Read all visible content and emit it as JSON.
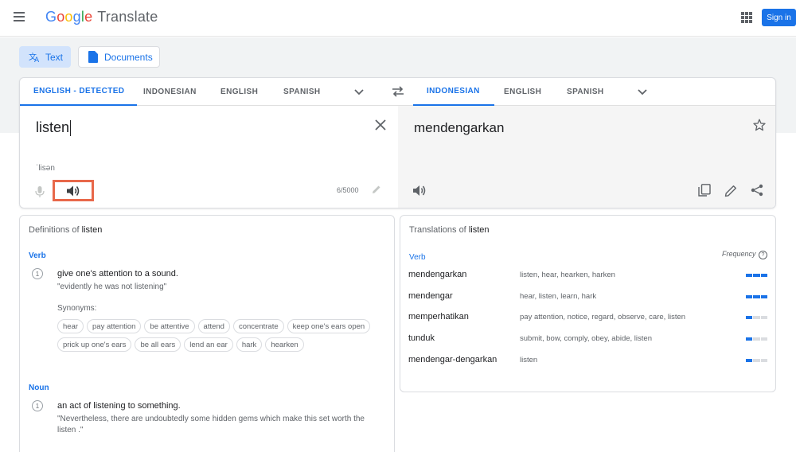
{
  "header": {
    "logo_letters": [
      "G",
      "o",
      "o",
      "g",
      "l",
      "e"
    ],
    "product": "Translate",
    "signin_label": "Sign in"
  },
  "modes": {
    "text_label": "Text",
    "documents_label": "Documents"
  },
  "source_tabs": [
    "ENGLISH - DETECTED",
    "INDONESIAN",
    "ENGLISH",
    "SPANISH"
  ],
  "target_tabs": [
    "INDONESIAN",
    "ENGLISH",
    "SPANISH"
  ],
  "source": {
    "text": "listen",
    "transliteration": "ˈlisən",
    "char_count": "6/5000"
  },
  "target": {
    "text": "mendengarkan"
  },
  "definitions": {
    "title_prefix": "Definitions of",
    "word": "listen",
    "verb_label": "Verb",
    "verb_num": "1",
    "verb_def": "give one's attention to a sound.",
    "verb_example": "\"evidently he was not listening\"",
    "synonyms_label": "Synonyms:",
    "synonyms": [
      "hear",
      "pay attention",
      "be attentive",
      "attend",
      "concentrate",
      "keep one's ears open",
      "prick up one's ears",
      "be all ears",
      "lend an ear",
      "hark",
      "hearken"
    ],
    "noun_label": "Noun",
    "noun_num": "1",
    "noun_def": "an act of listening to something.",
    "noun_example": "\"Nevertheless, there are undoubtedly some hidden gems which make this set worth the listen .\""
  },
  "translations": {
    "title_prefix": "Translations of",
    "word": "listen",
    "verb_label": "Verb",
    "frequency_label": "Frequency",
    "help_glyph": "?",
    "rows": [
      {
        "word": "mendengarkan",
        "synonyms": "listen, hear, hearken, harken",
        "frequency": 3
      },
      {
        "word": "mendengar",
        "synonyms": "hear, listen, learn, hark",
        "frequency": 3
      },
      {
        "word": "memperhatikan",
        "synonyms": "pay attention, notice, regard, observe, care, listen",
        "frequency": 1
      },
      {
        "word": "tunduk",
        "synonyms": "submit, bow, comply, obey, abide, listen",
        "frequency": 1
      },
      {
        "word": "mendengar-dengarkan",
        "synonyms": "listen",
        "frequency": 1
      }
    ]
  },
  "colors": {
    "accent": "#1a73e8",
    "highlight_box": "#e8684a"
  },
  "icons": [
    "menu-icon",
    "apps-icon",
    "translate-icon",
    "document-icon",
    "chevron-down-icon",
    "swap-icon",
    "close-icon",
    "mic-icon",
    "speaker-icon",
    "pencil-icon",
    "star-icon",
    "copy-icon",
    "edit-icon",
    "share-icon",
    "help-icon"
  ]
}
